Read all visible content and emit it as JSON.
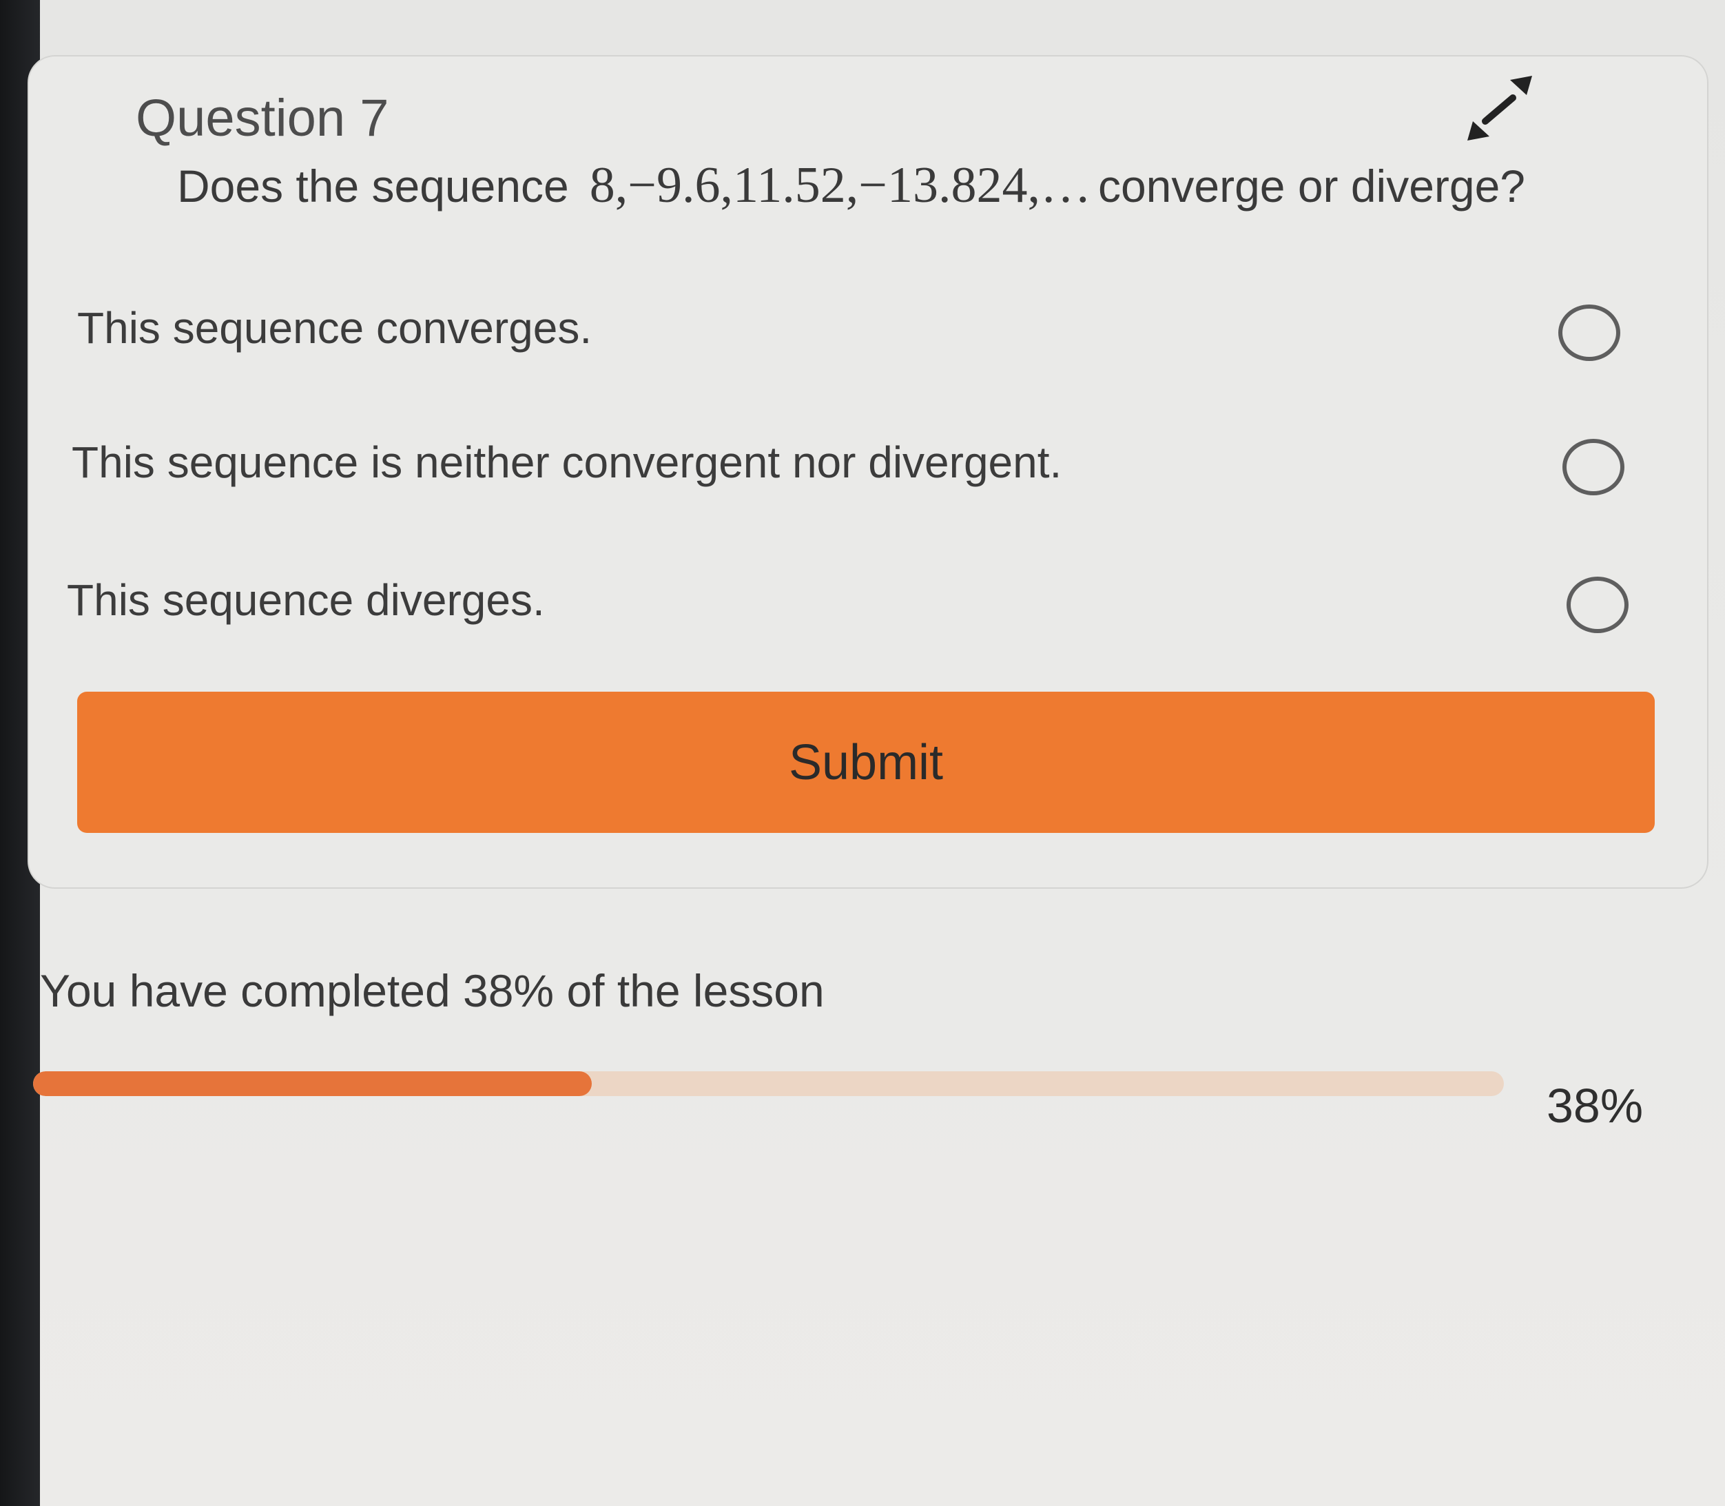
{
  "question": {
    "label": "Question 7",
    "prompt_before": "Does the sequence",
    "sequence": "8,−9.6,11.52,−13.824,…",
    "prompt_after": "converge or diverge?",
    "expand_icon": "expand-arrows-icon"
  },
  "options": [
    {
      "label": "This sequence converges.",
      "selected": false
    },
    {
      "label": "This sequence is neither convergent nor divergent.",
      "selected": false
    },
    {
      "label": "This sequence diverges.",
      "selected": false
    }
  ],
  "submit": {
    "label": "Submit",
    "color": "#ee7a30"
  },
  "progress": {
    "message": "You have completed 38% of the lesson",
    "percent": 38,
    "percent_label": "38%",
    "fill_color": "#e6743a",
    "track_color": "#ecd6c5"
  }
}
